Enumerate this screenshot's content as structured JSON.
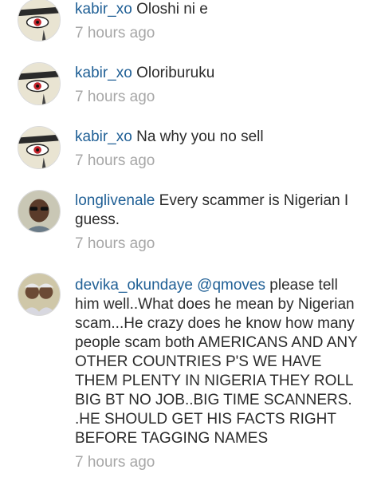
{
  "comments": [
    {
      "username": "kabir_xo",
      "text": "Oloshi ni e",
      "time": "7 hours ago",
      "avatar_icon": "anime-eye-avatar-icon"
    },
    {
      "username": "kabir_xo",
      "text": "Oloriburuku",
      "time": "7 hours ago",
      "avatar_icon": "anime-eye-avatar-icon"
    },
    {
      "username": "kabir_xo",
      "text": "Na why you no sell",
      "time": "7 hours ago",
      "avatar_icon": "anime-eye-avatar-icon"
    },
    {
      "username": "longlivenale",
      "text": "Every scammer is Nigerian I guess.",
      "time": "7 hours ago",
      "avatar_icon": "person-sunglasses-avatar-icon"
    },
    {
      "username": "devika_okundaye",
      "mention": "@qmoves",
      "text": "please tell him well..What does he mean by Nigerian scam...He crazy does he know how many people scam both AMERICANS AND ANY OTHER COUNTRIES P'S WE HAVE THEM PLENTY IN NIGERIA THEY ROLL BIG BT NO JOB..BIG TIME SCANNERS. .HE SHOULD GET HIS FACTS RIGHT BEFORE TAGGING NAMES",
      "time": "7 hours ago",
      "avatar_icon": "two-people-avatar-icon"
    }
  ],
  "colors": {
    "username": "#1f5f95",
    "text": "#2b2b2b",
    "time": "#a7a7a7"
  }
}
